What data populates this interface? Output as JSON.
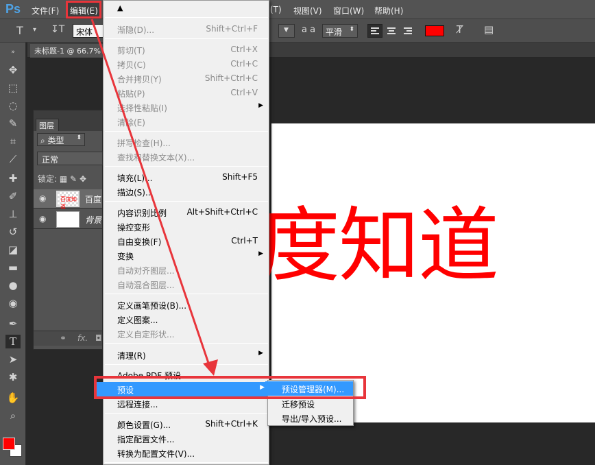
{
  "app": {
    "logo": "Ps",
    "accent_color": "#e8353b",
    "highlight_color": "#3399ff"
  },
  "menubar": {
    "file": "文件(F)",
    "edit": "编辑(E)",
    "type_partial": "(T)",
    "view": "视图(V)",
    "window": "窗口(W)",
    "help": "帮助(H)"
  },
  "options": {
    "tool_icon": "T",
    "font_family": "宋体",
    "antialias_label": "a a",
    "antialias": "平滑",
    "text_color": "#ff0000"
  },
  "document": {
    "tab_title": "未标题-1 @ 66.7%",
    "text": "度知道"
  },
  "layers_panel": {
    "tab": "图层",
    "kind_filter": "类型",
    "blend_mode": "正常",
    "lock_label": "锁定:",
    "layers": [
      {
        "name": "百度",
        "thumb_text": "百度知道"
      },
      {
        "name": "背景"
      }
    ],
    "footer_fx": "fx."
  },
  "edit_menu": {
    "items": [
      {
        "label": "渐隐(D)...",
        "shortcut": "Shift+Ctrl+F",
        "disabled": true
      },
      {
        "label": "剪切(T)",
        "shortcut": "Ctrl+X",
        "disabled": true
      },
      {
        "label": "拷贝(C)",
        "shortcut": "Ctrl+C",
        "disabled": true
      },
      {
        "label": "合并拷贝(Y)",
        "shortcut": "Shift+Ctrl+C",
        "disabled": true
      },
      {
        "label": "粘贴(P)",
        "shortcut": "Ctrl+V",
        "disabled": true
      },
      {
        "label": "选择性粘贴(I)",
        "shortcut": "",
        "disabled": true
      },
      {
        "label": "清除(E)",
        "shortcut": "",
        "disabled": true
      },
      {
        "label": "拼写检查(H)...",
        "shortcut": "",
        "disabled": true
      },
      {
        "label": "查找和替换文本(X)...",
        "shortcut": "",
        "disabled": true
      },
      {
        "label": "填充(L)...",
        "shortcut": "Shift+F5",
        "disabled": false
      },
      {
        "label": "描边(S)...",
        "shortcut": "",
        "disabled": false
      },
      {
        "label": "内容识别比例",
        "shortcut": "Alt+Shift+Ctrl+C",
        "disabled": false
      },
      {
        "label": "操控变形",
        "shortcut": "",
        "disabled": false
      },
      {
        "label": "自由变换(F)",
        "shortcut": "Ctrl+T",
        "disabled": false
      },
      {
        "label": "变换",
        "shortcut": "",
        "disabled": false
      },
      {
        "label": "自动对齐图层...",
        "shortcut": "",
        "disabled": true
      },
      {
        "label": "自动混合图层...",
        "shortcut": "",
        "disabled": true
      },
      {
        "label": "定义画笔预设(B)...",
        "shortcut": "",
        "disabled": false
      },
      {
        "label": "定义图案...",
        "shortcut": "",
        "disabled": false
      },
      {
        "label": "定义自定形状...",
        "shortcut": "",
        "disabled": true
      },
      {
        "label": "清理(R)",
        "shortcut": "",
        "disabled": false
      },
      {
        "label": "Adobe PDF 预设...",
        "shortcut": "",
        "disabled": false
      },
      {
        "label": "预设",
        "shortcut": "",
        "disabled": false
      },
      {
        "label": "远程连接...",
        "shortcut": "",
        "disabled": false
      },
      {
        "label": "颜色设置(G)...",
        "shortcut": "Shift+Ctrl+K",
        "disabled": false
      },
      {
        "label": "指定配置文件...",
        "shortcut": "",
        "disabled": false
      },
      {
        "label": "转换为配置文件(V)...",
        "shortcut": "",
        "disabled": false
      }
    ]
  },
  "preset_submenu": {
    "items": [
      {
        "label": "预设管理器(M)..."
      },
      {
        "label": "迁移预设"
      },
      {
        "label": "导出/导入预设..."
      }
    ]
  }
}
